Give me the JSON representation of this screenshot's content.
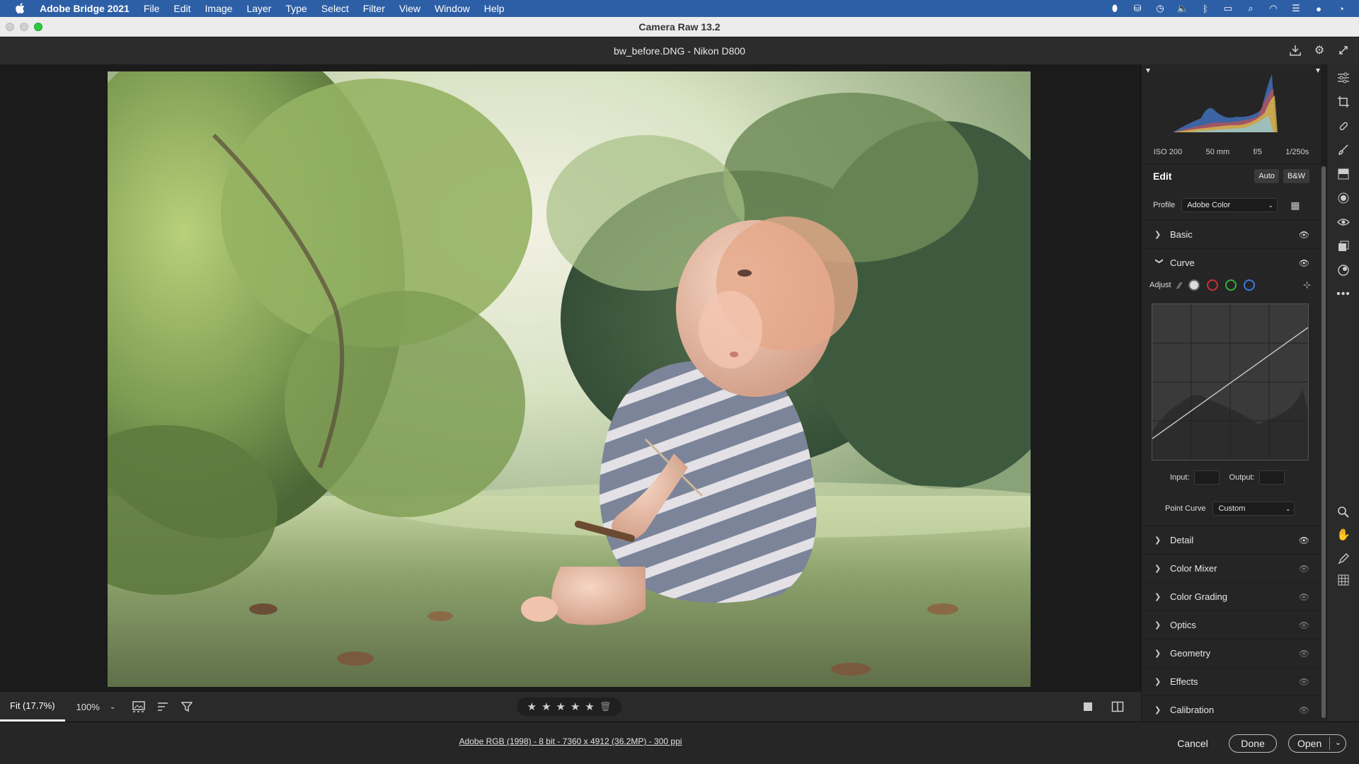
{
  "menubar": {
    "app_name": "Adobe Bridge 2021",
    "items": [
      "File",
      "Edit",
      "Image",
      "Layer",
      "Type",
      "Select",
      "Filter",
      "View",
      "Window",
      "Help"
    ],
    "color": "#2d5fa6"
  },
  "window": {
    "title": "Camera Raw 13.2"
  },
  "header": {
    "file_title": "bw_before.DNG  -  Nikon D800"
  },
  "exif": {
    "iso": "ISO 200",
    "focal": "50 mm",
    "aperture": "f/5",
    "shutter": "1/250s"
  },
  "edit": {
    "title": "Edit",
    "auto_label": "Auto",
    "bw_label": "B&W",
    "profile_label": "Profile",
    "profile_value": "Adobe Color"
  },
  "sections": {
    "basic": "Basic",
    "curve": "Curve",
    "detail": "Detail",
    "color_mixer": "Color Mixer",
    "color_grading": "Color Grading",
    "optics": "Optics",
    "geometry": "Geometry",
    "effects": "Effects",
    "calibration": "Calibration"
  },
  "curve": {
    "adjust_label": "Adjust",
    "input_label": "Input:",
    "output_label": "Output:",
    "point_curve_label": "Point Curve",
    "point_curve_value": "Custom"
  },
  "toolbar": {
    "fit_label": "Fit (17.7%)",
    "zoom_label": "100%",
    "rating_stars": 0
  },
  "footer": {
    "info": "Adobe RGB (1998) - 8 bit - 7360 x 4912 (36.2MP) - 300 ppi",
    "cancel": "Cancel",
    "done": "Done",
    "open": "Open"
  }
}
